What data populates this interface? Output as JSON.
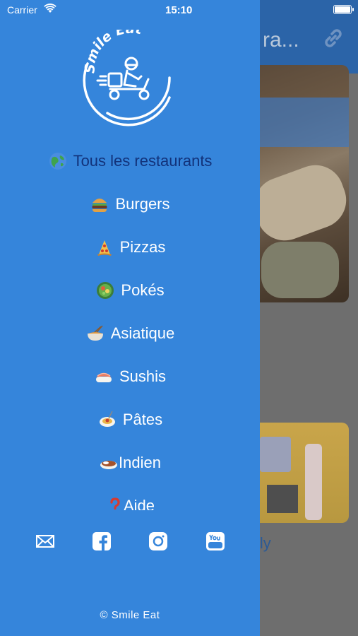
{
  "status_bar": {
    "carrier": "Carrier",
    "time": "15:10"
  },
  "background": {
    "title": "ra...",
    "card_text": "lyly"
  },
  "logo": {
    "text": "Smile Eat"
  },
  "menu": {
    "items": [
      {
        "label": "Tous les restaurants",
        "icon": "globe-icon",
        "active": true
      },
      {
        "label": "Burgers",
        "icon": "burger-icon"
      },
      {
        "label": "Pizzas",
        "icon": "pizza-icon"
      },
      {
        "label": "Pokés",
        "icon": "poke-bowl-icon"
      },
      {
        "label": "Asiatique",
        "icon": "ramen-icon"
      },
      {
        "label": "Sushis",
        "icon": "sushi-icon"
      },
      {
        "label": "Pâtes",
        "icon": "spaghetti-icon"
      },
      {
        "label": "Indien",
        "icon": "curry-icon"
      },
      {
        "label": "Aide",
        "icon": "question-mark-icon"
      }
    ]
  },
  "socials": [
    "mail-icon",
    "facebook-icon",
    "instagram-icon",
    "youtube-icon"
  ],
  "footer": {
    "copyright": "© Smile Eat"
  },
  "colors": {
    "drawer": "#3585db",
    "active_item": "#12327a",
    "navbar": "#2b64a8"
  }
}
